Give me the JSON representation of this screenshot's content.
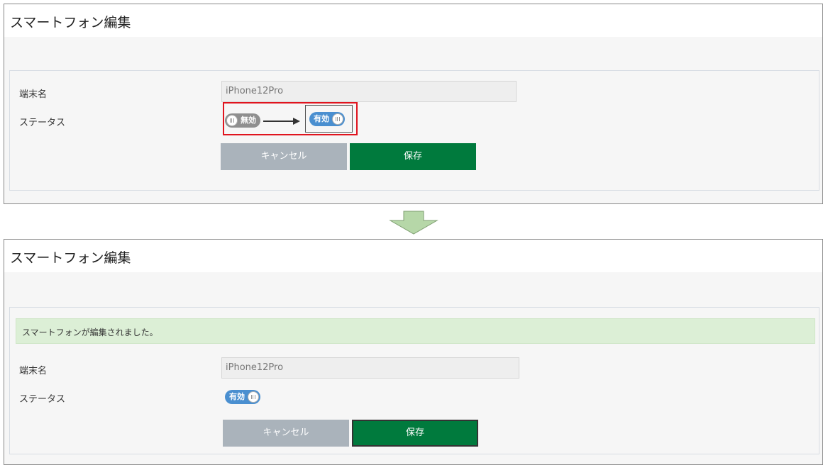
{
  "panel_title": "スマートフォン編集",
  "labels": {
    "device_name": "端末名",
    "status": "ステータス"
  },
  "device_name_value": "iPhone12Pro",
  "toggle": {
    "disabled_label": "無効",
    "enabled_label": "有効"
  },
  "buttons": {
    "cancel": "キャンセル",
    "save": "保存"
  },
  "alert_message": "スマートフォンが編集されました。",
  "colors": {
    "save_button": "#007a3d",
    "cancel_button": "#aab3bb",
    "toggle_on": "#4a8fd0",
    "toggle_off": "#8f8f8f",
    "highlight_box": "#e0141e",
    "alert_background": "#dcefd6",
    "transition_arrow": "#b6d7a8"
  },
  "icons": {
    "transition": "down-arrow-icon",
    "change": "right-arrow-icon"
  }
}
